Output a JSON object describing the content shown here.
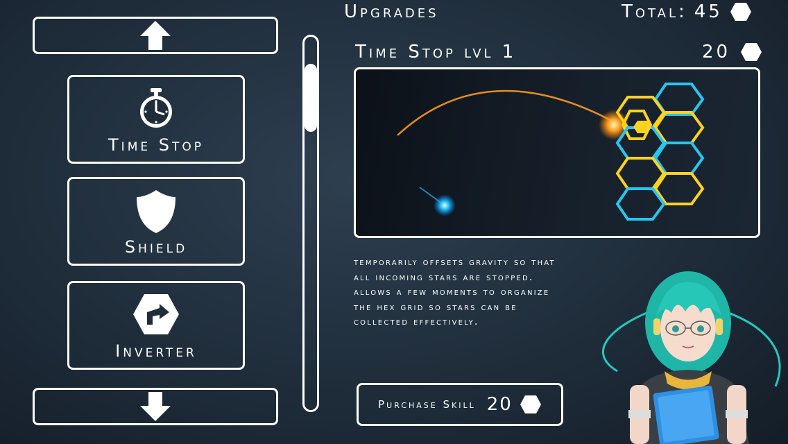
{
  "header": {
    "title": "Upgrades",
    "total_label": "Total:",
    "total_value": "45"
  },
  "skill_list": [
    {
      "label": "Time Stop",
      "icon": "stopwatch-icon"
    },
    {
      "label": "Shield",
      "icon": "shield-icon"
    },
    {
      "label": "Inverter",
      "icon": "inverter-hex-icon"
    }
  ],
  "scroll": {
    "up_icon": "arrow-up-icon",
    "down_icon": "arrow-down-icon"
  },
  "detail": {
    "title": "Time Stop lvl 1",
    "cost": "20",
    "description_lines": [
      "temporarily offsets gravity so that",
      "all incoming stars are stopped.",
      "Allows a few moments to organize",
      "the hex grid so stars can be",
      "collected effectively."
    ]
  },
  "purchase": {
    "label": "Purchase Skill",
    "cost": "20"
  },
  "colors": {
    "accent_orange": "#ff9a1f",
    "hex_yellow": "#ffd21f",
    "hex_blue": "#26c6f0",
    "frame": "#ffffff"
  }
}
